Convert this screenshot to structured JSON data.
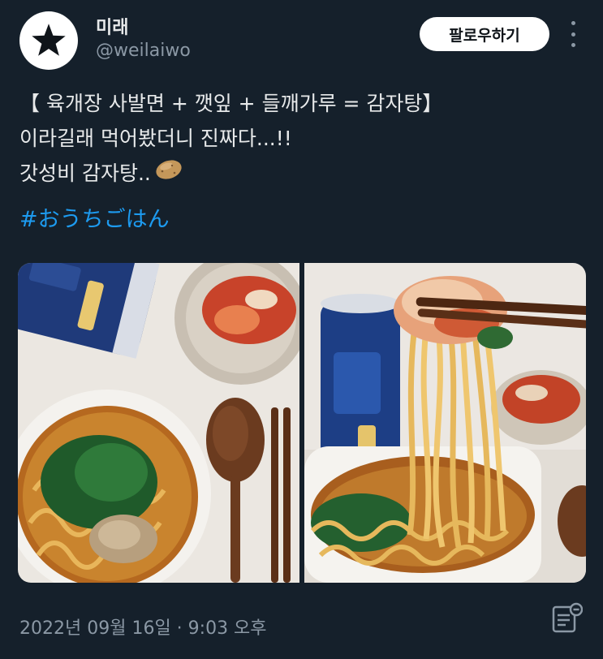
{
  "author": {
    "display_name": "미래",
    "handle": "@weilaiwo",
    "avatar_icon": "black-star-icon"
  },
  "header": {
    "follow_label": "팔로우하기",
    "more_icon": "more-vertical-icon"
  },
  "tweet": {
    "lines": [
      "【 육개장 사발면 + 깻잎 + 들깨가루 = 감자탕】",
      "이라길래 먹어봤더니 진짜다...!!",
      "갓성비 감자탕.."
    ],
    "emoji": "potato-emoji",
    "hashtag": "#おうちごはん"
  },
  "media": {
    "photos": [
      {
        "name": "ramen-top-view-photo"
      },
      {
        "name": "noodles-chopsticks-photo"
      }
    ]
  },
  "footer": {
    "timestamp": "2022년 09월 16일 · 9:03 오후",
    "views_icon": "views-icon"
  },
  "colors": {
    "background": "#15202b",
    "text": "#e7e9ea",
    "secondary": "#8b98a5",
    "link": "#1d9bf0"
  }
}
